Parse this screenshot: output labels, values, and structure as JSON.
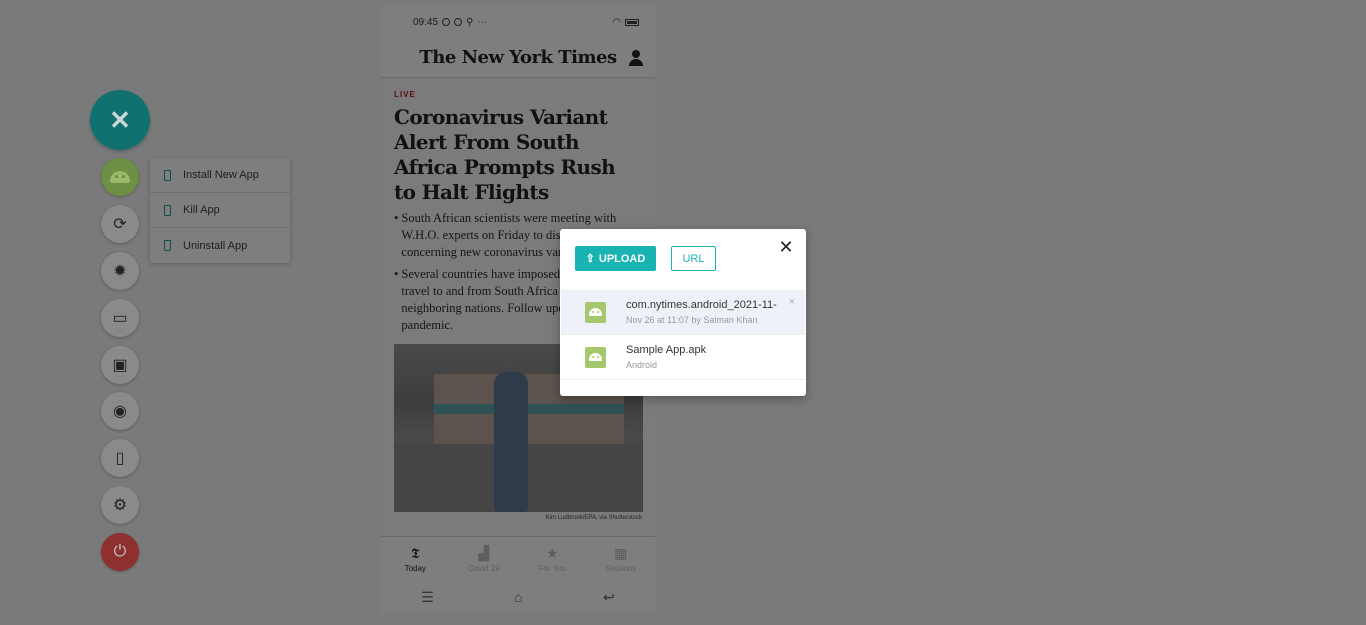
{
  "phone": {
    "status": {
      "time": "09:45"
    },
    "masthead": "The New York Times",
    "article": {
      "live_tag": "LIVE",
      "headline": "Coronavirus Variant Alert From South Africa Prompts Rush to Halt Flights",
      "bullets": [
        "South African scientists were meeting with W.H.O. experts on Friday to discuss a concerning new coronavirus variant.",
        "Several countries have imposed restrictions on travel to and from South Africa and some of its neighboring nations. Follow updates on the pandemic."
      ],
      "photo_credit": "Kim Ludbrook/EPA, via Shutterstock"
    },
    "tabs": [
      {
        "label": "Today",
        "icon": "nyt-t-icon"
      },
      {
        "label": "Covid 19",
        "icon": "chart-icon"
      },
      {
        "label": "For You",
        "icon": "star-icon"
      },
      {
        "label": "Sections",
        "icon": "grid-icon"
      }
    ],
    "nav": [
      "menu-icon",
      "home-icon",
      "back-icon"
    ]
  },
  "sidebar": {
    "close_symbol": "✕",
    "buttons": [
      "android-icon",
      "sync-icon",
      "bug-icon",
      "video-icon",
      "gallery-icon",
      "location-icon",
      "sim-icon",
      "gear-icon",
      "power-icon"
    ]
  },
  "app_menu": {
    "items": [
      "Install New App",
      "Kill App",
      "Uninstall App"
    ]
  },
  "modal": {
    "upload_label": "UPLOAD",
    "url_label": "URL",
    "close_symbol": "✕",
    "apps": [
      {
        "name": "com.nytimes.android_2021-11-",
        "sub": "Nov 26 at 11:07 by Salman Khan"
      },
      {
        "name": "Sample App.apk",
        "sub": "Android"
      }
    ]
  },
  "colors": {
    "teal": "#19b3b1",
    "android_green": "#a4c86b",
    "power_red": "#d33b3d",
    "fab_teal": "#1a9a98"
  }
}
